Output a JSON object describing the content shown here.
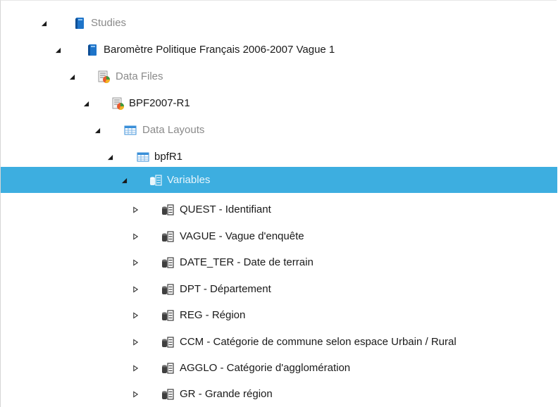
{
  "tree": {
    "studies": {
      "label": "Studies",
      "icon": "book-icon"
    },
    "study": {
      "label": "Baromètre Politique Français 2006-2007 Vague 1",
      "icon": "book-icon"
    },
    "data_files": {
      "label": "Data Files",
      "icon": "data-file-icon"
    },
    "data_file": {
      "label": "BPF2007-R1",
      "icon": "data-file-icon"
    },
    "data_layouts": {
      "label": "Data Layouts",
      "icon": "table-icon"
    },
    "data_layout": {
      "label": "bpfR1",
      "icon": "table-icon"
    },
    "variables": {
      "label": "Variables",
      "icon": "variable-icon",
      "selected": true
    },
    "variable_items": [
      {
        "label": "QUEST - Identifiant"
      },
      {
        "label": "VAGUE - Vague d'enquête"
      },
      {
        "label": "DATE_TER - Date de terrain"
      },
      {
        "label": "DPT - Département"
      },
      {
        "label": "REG - Région"
      },
      {
        "label": "CCM - Catégorie de commune selon espace Urbain / Rural"
      },
      {
        "label": "AGGLO - Catégorie d'agglomération"
      },
      {
        "label": "GR - Grande région"
      }
    ]
  },
  "colors": {
    "selection": "#3daee0",
    "book": "#1e74c9",
    "muted_text": "#8a8a8a"
  }
}
